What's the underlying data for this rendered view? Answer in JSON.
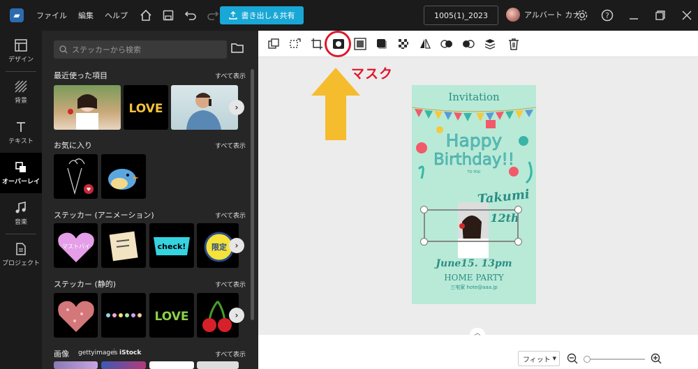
{
  "menu": {
    "file": "ファイル",
    "edit": "編集",
    "help": "ヘルプ"
  },
  "export_label": "書き出し＆共有",
  "project_name": "1005(1)_2023",
  "user_name": "アルバート カナ",
  "nav": [
    {
      "label": "デザイン"
    },
    {
      "label": "背景"
    },
    {
      "label": "テキスト"
    },
    {
      "label": "オーバーレイ"
    },
    {
      "label": "音楽"
    },
    {
      "label": "プロジェクト"
    }
  ],
  "search_placeholder": "ステッカーから検索",
  "see_all": "すべて表示",
  "sections": {
    "recent": "最近使った項目",
    "favorites": "お気に入り",
    "anim": "ステッカー (アニメーション)",
    "static": "ステッカー (静的)",
    "images": "画像"
  },
  "sticker_text": {
    "love": "LOVE",
    "check": "check!",
    "limited": "限定",
    "must_buy": "マストバイ"
  },
  "images_brand": {
    "getty": "gettyimages",
    "istock": "iStock"
  },
  "annotation": "マスク",
  "card": {
    "invitation": "Invitation",
    "happy": "Happy",
    "birthday": "Birthday!!",
    "to_you": "TO YOU",
    "name": "Takumi",
    "age": "12th",
    "date": "June15. 13pm",
    "party": "HOME PARTY",
    "address": "三宅家 hote@aaa.jp"
  },
  "zoom": {
    "fit": "フィット",
    "level": 0
  },
  "colors": {
    "accent": "#19a7d6",
    "annotation": "#e0162a",
    "arrow": "#f5bd2e",
    "card_bg": "#b8ead7",
    "card_text": "#2b8d84"
  }
}
